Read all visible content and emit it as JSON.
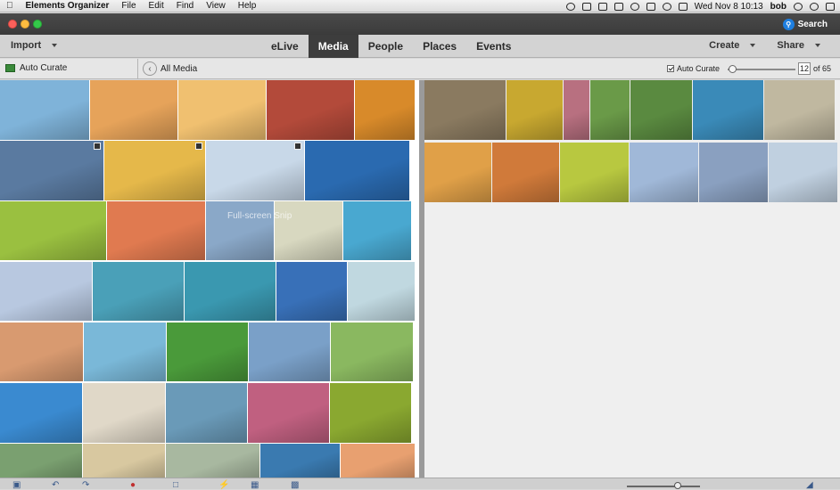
{
  "menubar": {
    "app": "Elements Organizer",
    "items": [
      "File",
      "Edit",
      "Find",
      "View",
      "Help"
    ],
    "clock": "Wed Nov 8  10:13",
    "user": "bob"
  },
  "titlebar": {
    "search": "Search"
  },
  "toolbar": {
    "import": "Import",
    "tabs": [
      {
        "label": "eLive",
        "active": false
      },
      {
        "label": "Media",
        "active": true
      },
      {
        "label": "People",
        "active": false
      },
      {
        "label": "Places",
        "active": false
      },
      {
        "label": "Events",
        "active": false
      }
    ],
    "create": "Create",
    "share": "Share"
  },
  "subbar": {
    "auto_curate_left": "Auto Curate",
    "all_media": "All Media",
    "auto_curate_check": "Auto Curate",
    "page_value": "12",
    "page_of": "of 65"
  },
  "watermark": "Full-screen Snip",
  "photos_left_rows": [
    [
      "#7fb3d9",
      "#e6a35a",
      "#f0c070",
      "#b34a3a",
      "#d88a2a"
    ],
    [
      "#5a7aa0",
      "#e5b84a",
      "#c8d8e8",
      "#2a6ab0"
    ],
    [
      "#9ac040",
      "#e07a50",
      "#8aa8c8",
      "#d8d8c0",
      "#49a8d0"
    ],
    [
      "#b8c8e0",
      "#4aa0b8",
      "#3a98b0",
      "#3870b8",
      "#c0d8e0"
    ],
    [
      "#d89a70",
      "#7ab8d8",
      "#4a9a3a",
      "#7aa0c8",
      "#8ab860"
    ],
    [
      "#3a8ad0",
      "#e0d8c8",
      "#6a9ab8",
      "#c06080",
      "#8aa830"
    ],
    [
      "#7aa070",
      "#d8c8a0",
      "#a8b8a0",
      "#3a7ab0",
      "#e8a070"
    ]
  ],
  "photos_right_rows": [
    [
      "#8a7a60",
      "#c8a830",
      "#b87080",
      "#6a9a48",
      "#5a8a40",
      "#3a8ab8",
      "#c0b8a0"
    ],
    [
      "#e0a048",
      "#d07a3a",
      "#b8c840",
      "#a0b8d8",
      "#8aa0c0",
      "#c0d0e0"
    ]
  ],
  "bottom_icons": [
    "photo-fix-icon",
    "undo-icon",
    "redo-icon",
    "map-pin-icon",
    "add-icon",
    "instant-fix-icon",
    "tag-icon",
    "slideshow-icon",
    "tag-corner-icon"
  ]
}
